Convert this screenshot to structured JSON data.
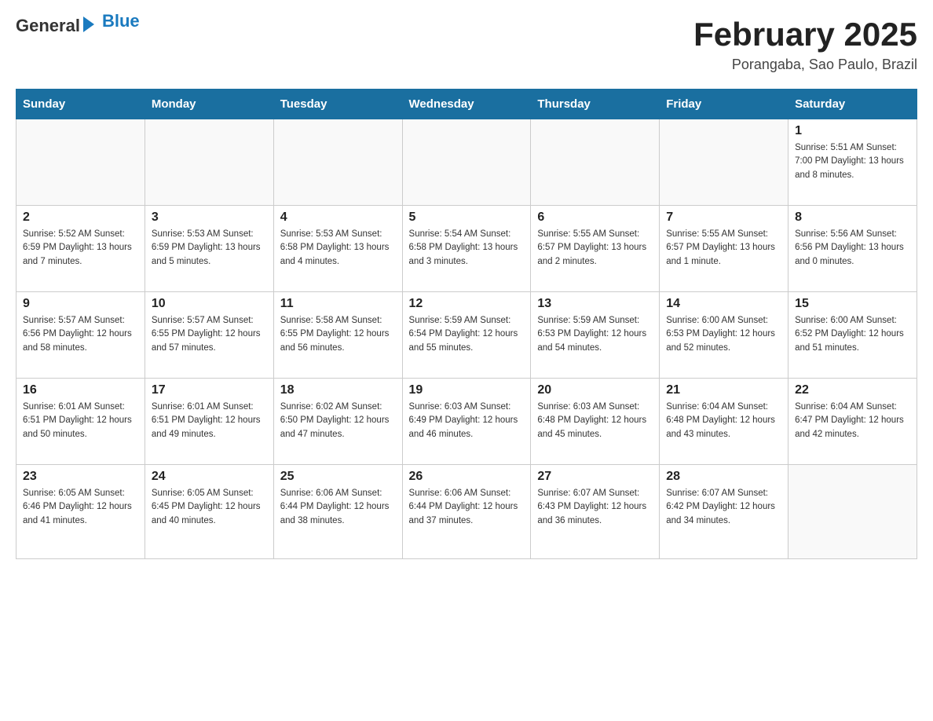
{
  "header": {
    "logo_general": "General",
    "logo_blue": "Blue",
    "month_title": "February 2025",
    "location": "Porangaba, Sao Paulo, Brazil"
  },
  "weekdays": [
    "Sunday",
    "Monday",
    "Tuesday",
    "Wednesday",
    "Thursday",
    "Friday",
    "Saturday"
  ],
  "weeks": [
    [
      {
        "day": "",
        "info": ""
      },
      {
        "day": "",
        "info": ""
      },
      {
        "day": "",
        "info": ""
      },
      {
        "day": "",
        "info": ""
      },
      {
        "day": "",
        "info": ""
      },
      {
        "day": "",
        "info": ""
      },
      {
        "day": "1",
        "info": "Sunrise: 5:51 AM\nSunset: 7:00 PM\nDaylight: 13 hours and 8 minutes."
      }
    ],
    [
      {
        "day": "2",
        "info": "Sunrise: 5:52 AM\nSunset: 6:59 PM\nDaylight: 13 hours and 7 minutes."
      },
      {
        "day": "3",
        "info": "Sunrise: 5:53 AM\nSunset: 6:59 PM\nDaylight: 13 hours and 5 minutes."
      },
      {
        "day": "4",
        "info": "Sunrise: 5:53 AM\nSunset: 6:58 PM\nDaylight: 13 hours and 4 minutes."
      },
      {
        "day": "5",
        "info": "Sunrise: 5:54 AM\nSunset: 6:58 PM\nDaylight: 13 hours and 3 minutes."
      },
      {
        "day": "6",
        "info": "Sunrise: 5:55 AM\nSunset: 6:57 PM\nDaylight: 13 hours and 2 minutes."
      },
      {
        "day": "7",
        "info": "Sunrise: 5:55 AM\nSunset: 6:57 PM\nDaylight: 13 hours and 1 minute."
      },
      {
        "day": "8",
        "info": "Sunrise: 5:56 AM\nSunset: 6:56 PM\nDaylight: 13 hours and 0 minutes."
      }
    ],
    [
      {
        "day": "9",
        "info": "Sunrise: 5:57 AM\nSunset: 6:56 PM\nDaylight: 12 hours and 58 minutes."
      },
      {
        "day": "10",
        "info": "Sunrise: 5:57 AM\nSunset: 6:55 PM\nDaylight: 12 hours and 57 minutes."
      },
      {
        "day": "11",
        "info": "Sunrise: 5:58 AM\nSunset: 6:55 PM\nDaylight: 12 hours and 56 minutes."
      },
      {
        "day": "12",
        "info": "Sunrise: 5:59 AM\nSunset: 6:54 PM\nDaylight: 12 hours and 55 minutes."
      },
      {
        "day": "13",
        "info": "Sunrise: 5:59 AM\nSunset: 6:53 PM\nDaylight: 12 hours and 54 minutes."
      },
      {
        "day": "14",
        "info": "Sunrise: 6:00 AM\nSunset: 6:53 PM\nDaylight: 12 hours and 52 minutes."
      },
      {
        "day": "15",
        "info": "Sunrise: 6:00 AM\nSunset: 6:52 PM\nDaylight: 12 hours and 51 minutes."
      }
    ],
    [
      {
        "day": "16",
        "info": "Sunrise: 6:01 AM\nSunset: 6:51 PM\nDaylight: 12 hours and 50 minutes."
      },
      {
        "day": "17",
        "info": "Sunrise: 6:01 AM\nSunset: 6:51 PM\nDaylight: 12 hours and 49 minutes."
      },
      {
        "day": "18",
        "info": "Sunrise: 6:02 AM\nSunset: 6:50 PM\nDaylight: 12 hours and 47 minutes."
      },
      {
        "day": "19",
        "info": "Sunrise: 6:03 AM\nSunset: 6:49 PM\nDaylight: 12 hours and 46 minutes."
      },
      {
        "day": "20",
        "info": "Sunrise: 6:03 AM\nSunset: 6:48 PM\nDaylight: 12 hours and 45 minutes."
      },
      {
        "day": "21",
        "info": "Sunrise: 6:04 AM\nSunset: 6:48 PM\nDaylight: 12 hours and 43 minutes."
      },
      {
        "day": "22",
        "info": "Sunrise: 6:04 AM\nSunset: 6:47 PM\nDaylight: 12 hours and 42 minutes."
      }
    ],
    [
      {
        "day": "23",
        "info": "Sunrise: 6:05 AM\nSunset: 6:46 PM\nDaylight: 12 hours and 41 minutes."
      },
      {
        "day": "24",
        "info": "Sunrise: 6:05 AM\nSunset: 6:45 PM\nDaylight: 12 hours and 40 minutes."
      },
      {
        "day": "25",
        "info": "Sunrise: 6:06 AM\nSunset: 6:44 PM\nDaylight: 12 hours and 38 minutes."
      },
      {
        "day": "26",
        "info": "Sunrise: 6:06 AM\nSunset: 6:44 PM\nDaylight: 12 hours and 37 minutes."
      },
      {
        "day": "27",
        "info": "Sunrise: 6:07 AM\nSunset: 6:43 PM\nDaylight: 12 hours and 36 minutes."
      },
      {
        "day": "28",
        "info": "Sunrise: 6:07 AM\nSunset: 6:42 PM\nDaylight: 12 hours and 34 minutes."
      },
      {
        "day": "",
        "info": ""
      }
    ]
  ]
}
